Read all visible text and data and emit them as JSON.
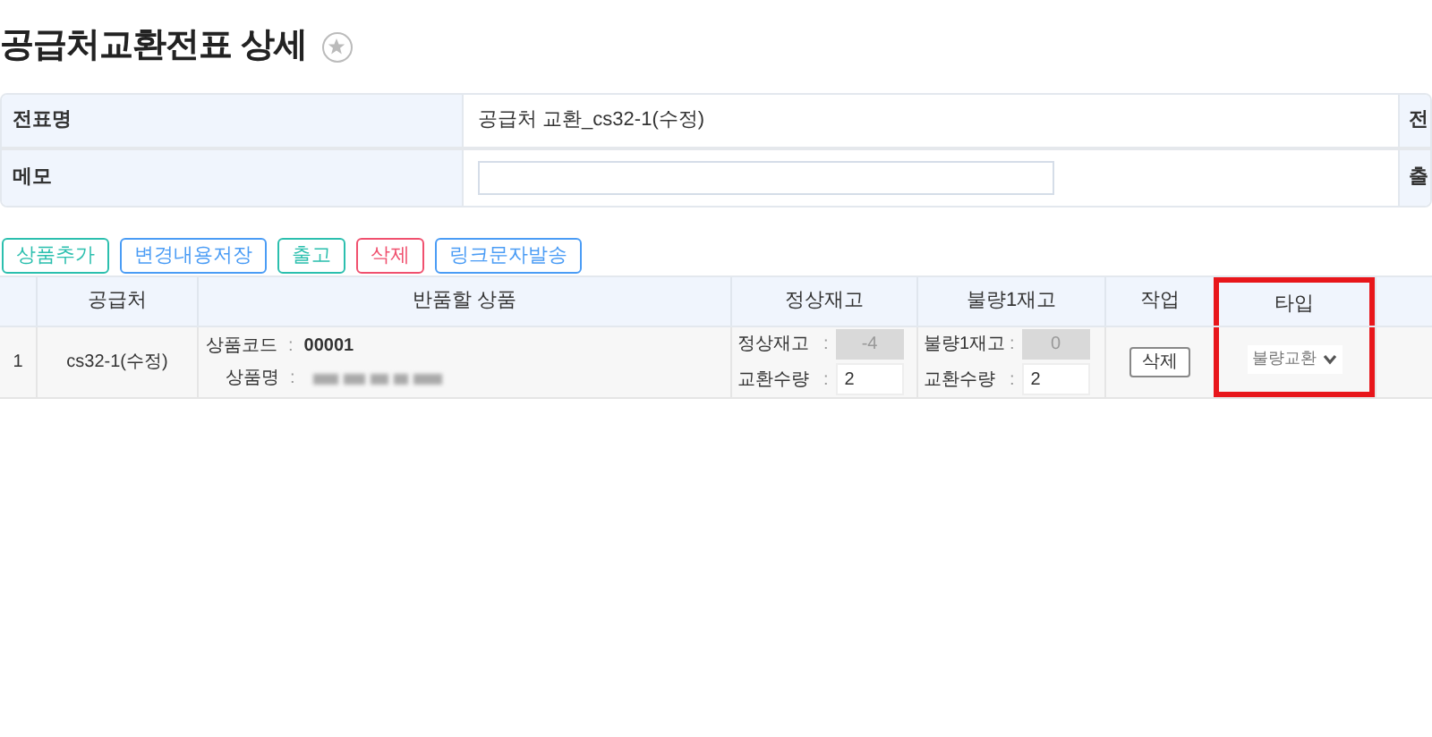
{
  "title": "공급처교환전표 상세",
  "info": {
    "rows": [
      {
        "label": "전표명",
        "value": "공급처 교환_cs32-1(수정)",
        "kind": "text",
        "side_label": "전"
      },
      {
        "label": "메모",
        "kind": "input",
        "side_label": "출"
      }
    ]
  },
  "buttons": [
    {
      "label": "상품추가",
      "color": "#2bbfae"
    },
    {
      "label": "변경내용저장",
      "color": "#4a9cf5"
    },
    {
      "label": "출고",
      "color": "#2bbfae"
    },
    {
      "label": "삭제",
      "color": "#f0506e"
    },
    {
      "label": "링크문자발송",
      "color": "#4a9cf5"
    }
  ],
  "table": {
    "columns": [
      {
        "label": "공급처",
        "highlighted": false
      },
      {
        "label": "반품할 상품",
        "highlighted": false
      },
      {
        "label": "정상재고",
        "highlighted": false
      },
      {
        "label": "불량1재고",
        "highlighted": false
      },
      {
        "label": "작업",
        "highlighted": false
      },
      {
        "label": "타입",
        "highlighted": true
      }
    ],
    "rows": [
      {
        "index": "1",
        "supplier": "cs32-1(수정)",
        "code_label": "상품코드",
        "code": "00001",
        "name_label": "상품명",
        "separators": [
          ":",
          ":",
          ":",
          ":",
          ":",
          ":"
        ],
        "normal_label": "정상재고",
        "normal": "-4",
        "normal_qty_label": "교환수량",
        "normal_qty": "2",
        "bad_label": "불량1재고",
        "bad": "0",
        "bad_qty_label": "교환수량",
        "bad_qty": "2",
        "action": "삭제",
        "type": "불량교환"
      }
    ]
  }
}
